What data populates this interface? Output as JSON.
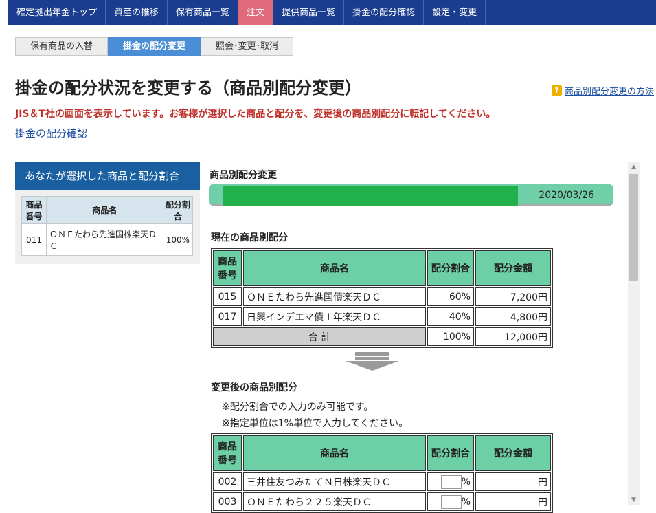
{
  "topnav": {
    "items": [
      "確定拠出年金トップ",
      "資産の推移",
      "保有商品一覧",
      "注文",
      "提供商品一覧",
      "掛金の配分確認",
      "設定・変更"
    ],
    "active_index": 3
  },
  "subtabs": [
    "保有商品の入替",
    "掛金の配分変更",
    "照会･変更･取消"
  ],
  "page": {
    "title": "掛金の配分状況を変更する（商品別配分変更）",
    "help_link": "商品別配分変更の方法",
    "notice": "JIS＆T社の画面を表示しています。お客様が選択した商品と配分を、変更後の商品別配分に転記してください。",
    "confirm_link": "掛金の配分確認"
  },
  "left_panel": {
    "header": "あなたが選択した商品と配分割合",
    "columns": [
      "商品番号",
      "商品名",
      "配分割合"
    ],
    "rows": [
      {
        "code": "011",
        "name": "ＯＮＥたわら先進国株楽天ＤＣ",
        "pct": "100%"
      }
    ]
  },
  "main": {
    "section_title": "商品別配分変更",
    "date": "2020/03/26",
    "progress_fraction": 0.73,
    "current": {
      "title": "現在の商品別配分",
      "columns": [
        "商品番号",
        "商品名",
        "配分割合",
        "配分金額"
      ],
      "rows": [
        {
          "code": "015",
          "name": "ＯＮＥたわら先進国債楽天ＤＣ",
          "pct": "60%",
          "amount": "7,200円"
        },
        {
          "code": "017",
          "name": "日興インデエマ債１年楽天ＤＣ",
          "pct": "40%",
          "amount": "4,800円"
        }
      ],
      "total_label": "合 計",
      "total_pct": "100%",
      "total_amount": "12,000円"
    },
    "after": {
      "title": "変更後の商品別配分",
      "notes": [
        "※配分割合での入力のみ可能です。",
        "※指定単位は1%単位で入力してください。"
      ],
      "columns": [
        "商品番号",
        "商品名",
        "配分割合",
        "配分金額"
      ],
      "rows": [
        {
          "code": "002",
          "name": "三井住友つみたてＮ日株楽天ＤＣ",
          "pct_suffix": "%",
          "amount": "円"
        },
        {
          "code": "003",
          "name": "ＯＮＥたわら２２５楽天ＤＣ",
          "pct_suffix": "%",
          "amount": "円"
        }
      ]
    }
  }
}
